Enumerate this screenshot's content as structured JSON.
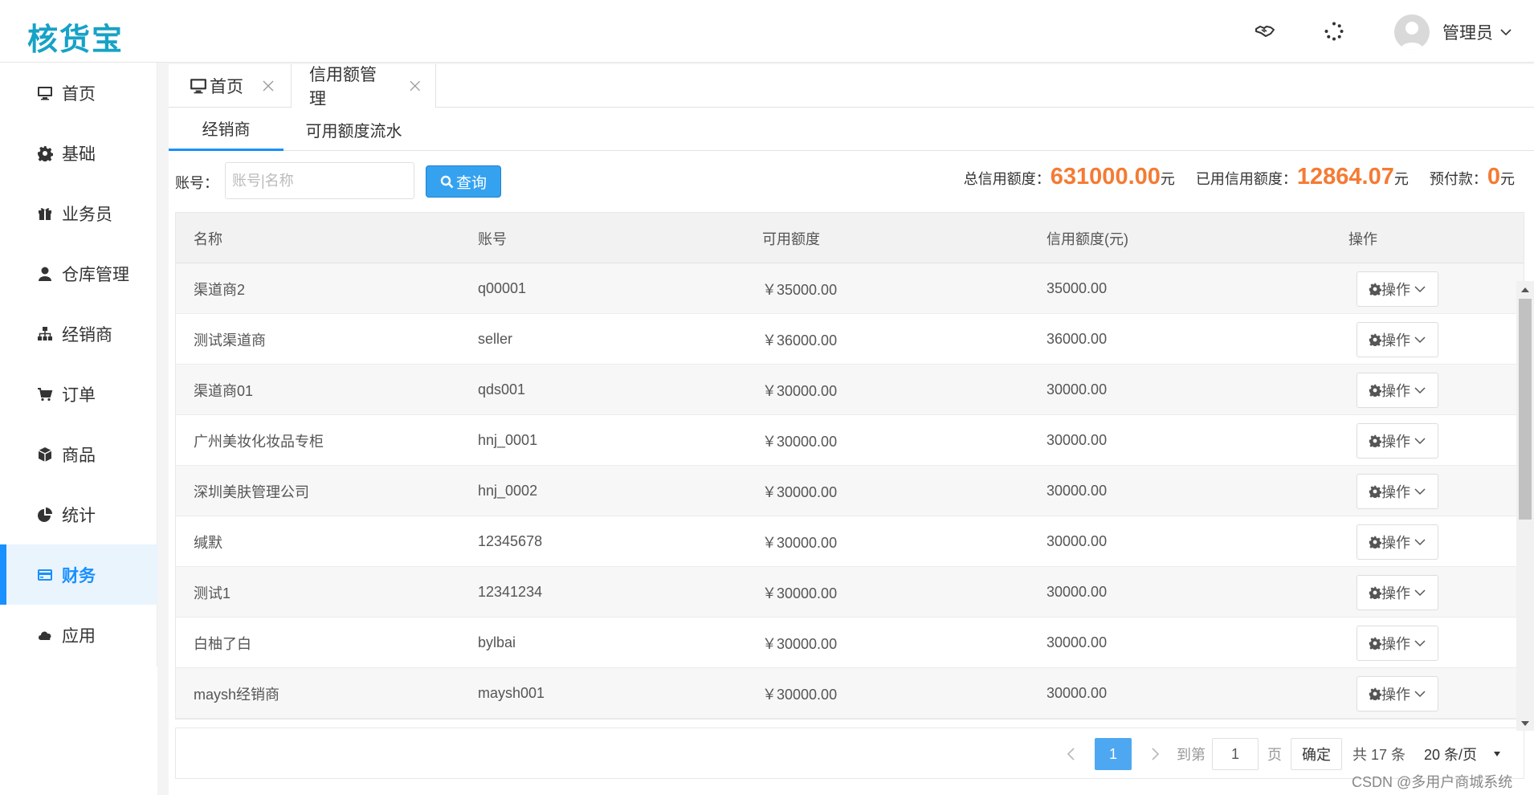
{
  "header": {
    "logo": "核货宝",
    "user_name": "管理员"
  },
  "sidebar": {
    "items": [
      {
        "label": "首页",
        "icon": "monitor-icon"
      },
      {
        "label": "基础",
        "icon": "gear-icon"
      },
      {
        "label": "业务员",
        "icon": "gift-icon"
      },
      {
        "label": "仓库管理",
        "icon": "user-icon"
      },
      {
        "label": "经销商",
        "icon": "sitemap-icon"
      },
      {
        "label": "订单",
        "icon": "cart-icon"
      },
      {
        "label": "商品",
        "icon": "cube-icon"
      },
      {
        "label": "统计",
        "icon": "pie-icon"
      },
      {
        "label": "财务",
        "icon": "card-icon",
        "active": true
      },
      {
        "label": "应用",
        "icon": "cloud-icon"
      }
    ]
  },
  "page_tabs": [
    {
      "label": "首页"
    },
    {
      "label": "信用额管理",
      "active": true
    }
  ],
  "sub_tabs": [
    {
      "label": "经销商",
      "active": true
    },
    {
      "label": "可用额度流水"
    }
  ],
  "search": {
    "label": "账号：",
    "placeholder": "账号|名称",
    "button": "查询"
  },
  "summary": {
    "total_label": "总信用额度：",
    "total_value": "631000.00",
    "used_label": "已用信用额度：",
    "used_value": "12864.07",
    "prepaid_label": "预付款：",
    "prepaid_value": "0",
    "unit": "元"
  },
  "table": {
    "columns": [
      "名称",
      "账号",
      "可用额度",
      "信用额度(元)",
      "操作"
    ],
    "action_label": "操作",
    "rows": [
      {
        "name": "渠道商2",
        "account": "q00001",
        "available": "￥35000.00",
        "credit": "35000.00"
      },
      {
        "name": "测试渠道商",
        "account": "seller",
        "available": "￥36000.00",
        "credit": "36000.00"
      },
      {
        "name": "渠道商01",
        "account": "qds001",
        "available": "￥30000.00",
        "credit": "30000.00"
      },
      {
        "name": "广州美妆化妆品专柜",
        "account": "hnj_0001",
        "available": "￥30000.00",
        "credit": "30000.00"
      },
      {
        "name": "深圳美肤管理公司",
        "account": "hnj_0002",
        "available": "￥30000.00",
        "credit": "30000.00"
      },
      {
        "name": "缄默",
        "account": "12345678",
        "available": "￥30000.00",
        "credit": "30000.00"
      },
      {
        "name": "测试1",
        "account": "12341234",
        "available": "￥30000.00",
        "credit": "30000.00"
      },
      {
        "name": "白柚了白",
        "account": "bylbai",
        "available": "￥30000.00",
        "credit": "30000.00"
      },
      {
        "name": "maysh经销商",
        "account": "maysh001",
        "available": "￥30000.00",
        "credit": "30000.00"
      }
    ]
  },
  "pager": {
    "current_page": "1",
    "goto_label": "到第",
    "goto_value": "1",
    "page_suffix": "页",
    "confirm": "确定",
    "total": "共 17 条",
    "page_size": "20 条/页"
  },
  "watermark": "CSDN @多用户商城系统",
  "colors": {
    "accent": "#1890ff",
    "amount": "#f47b34",
    "logo": "#17a2c6"
  }
}
